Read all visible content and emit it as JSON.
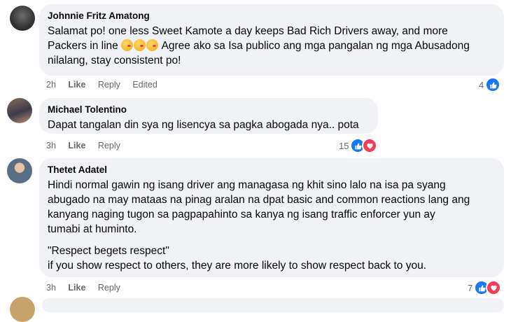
{
  "colors": {
    "bubble": "#f0f2f5",
    "meta_text": "#65676b",
    "like_blue": "#1877f2",
    "love_red": "#f33e58"
  },
  "comments": [
    {
      "author": "Johnnie Fritz Amatong",
      "avatar_icon": "profile-photo-dark",
      "lines": [
        "Salamat po! one less Sweet Kamote a day keeps Bad Rich Drivers away, and more",
        "Packers in line",
        "Agree ako sa Isa publico ang mga pangalan ng mga Abusadong",
        "nilalang, stay consistent po!"
      ],
      "emoji": [
        "face-blowing-kiss-emoji",
        "face-blowing-kiss-emoji",
        "face-blowing-kiss-emoji"
      ],
      "time": "2h",
      "like_label": "Like",
      "reply_label": "Reply",
      "edited_label": "Edited",
      "reaction_count": "4",
      "reactions": [
        "like"
      ]
    },
    {
      "author": "Michael Tolentino",
      "avatar_icon": "profile-photo-selfie",
      "lines": [
        "Dapat tangalan din sya ng lisencya sa pagka abogada nya.. pota"
      ],
      "time": "3h",
      "like_label": "Like",
      "reply_label": "Reply",
      "reaction_count": "15",
      "reactions": [
        "like",
        "love"
      ]
    },
    {
      "author": "Thetet Adatel",
      "avatar_icon": "profile-photo-person",
      "paragraph1": [
        "Hindi normal gawin ng isang driver ang managasa ng khit sino lalo na isa pa syang",
        "abugado na may mataas na pinag aralan na dpat basic and common reactions lang ang",
        "kanyang naging tugon sa pagpapahinto sa kanya ng isang traffic enforcer yun ay",
        "tumabi at huminto."
      ],
      "paragraph2": [
        "\"Respect begets respect\"",
        "if you show respect to others, they are more likely to show respect back to you."
      ],
      "time": "3h",
      "like_label": "Like",
      "reply_label": "Reply",
      "reaction_count": "7",
      "reactions": [
        "like",
        "love"
      ]
    }
  ]
}
